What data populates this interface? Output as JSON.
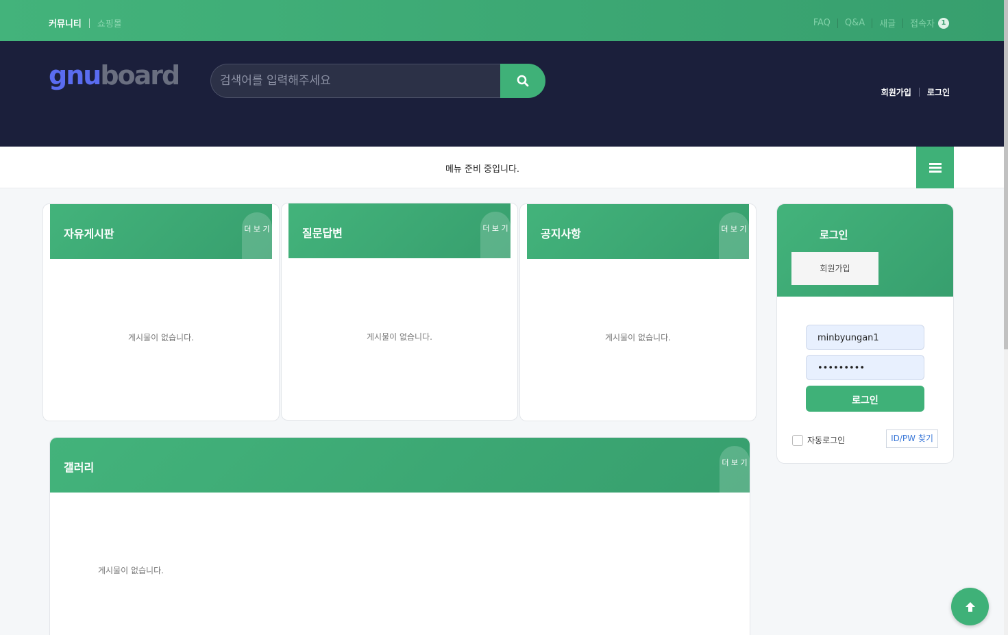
{
  "topbar": {
    "community": "커뮤니티",
    "shop": "쇼핑몰",
    "faq": "FAQ",
    "qa": "Q&A",
    "new_posts": "새글",
    "visitors": "접속자",
    "visitor_count": "1"
  },
  "header": {
    "logo_part1": "gnu",
    "logo_part2": "board",
    "search_placeholder": "검색어를 입력해주세요",
    "join": "회원가입",
    "login": "로그인"
  },
  "nav": {
    "message": "메뉴 준비 중입니다."
  },
  "boards": [
    {
      "title": "자유게시판",
      "more": "더 보 기",
      "empty": "게시물이 없습니다."
    },
    {
      "title": "질문답변",
      "more": "더 보 기",
      "empty": "게시물이 없습니다."
    },
    {
      "title": "공지사항",
      "more": "더 보 기",
      "empty": "게시물이 없습니다."
    }
  ],
  "gallery": {
    "title": "갤러리",
    "more": "더 보 기",
    "empty": "게시물이 없습니다."
  },
  "login_box": {
    "title": "로그인",
    "join": "회원가입",
    "username": "minbyungan1",
    "password": "•••••••••",
    "submit": "로그인",
    "auto_login": "자동로그인",
    "find": "ID/PW 찾기"
  },
  "colors": {
    "accent": "#3fb178",
    "header_bg": "#1b1f3b"
  }
}
